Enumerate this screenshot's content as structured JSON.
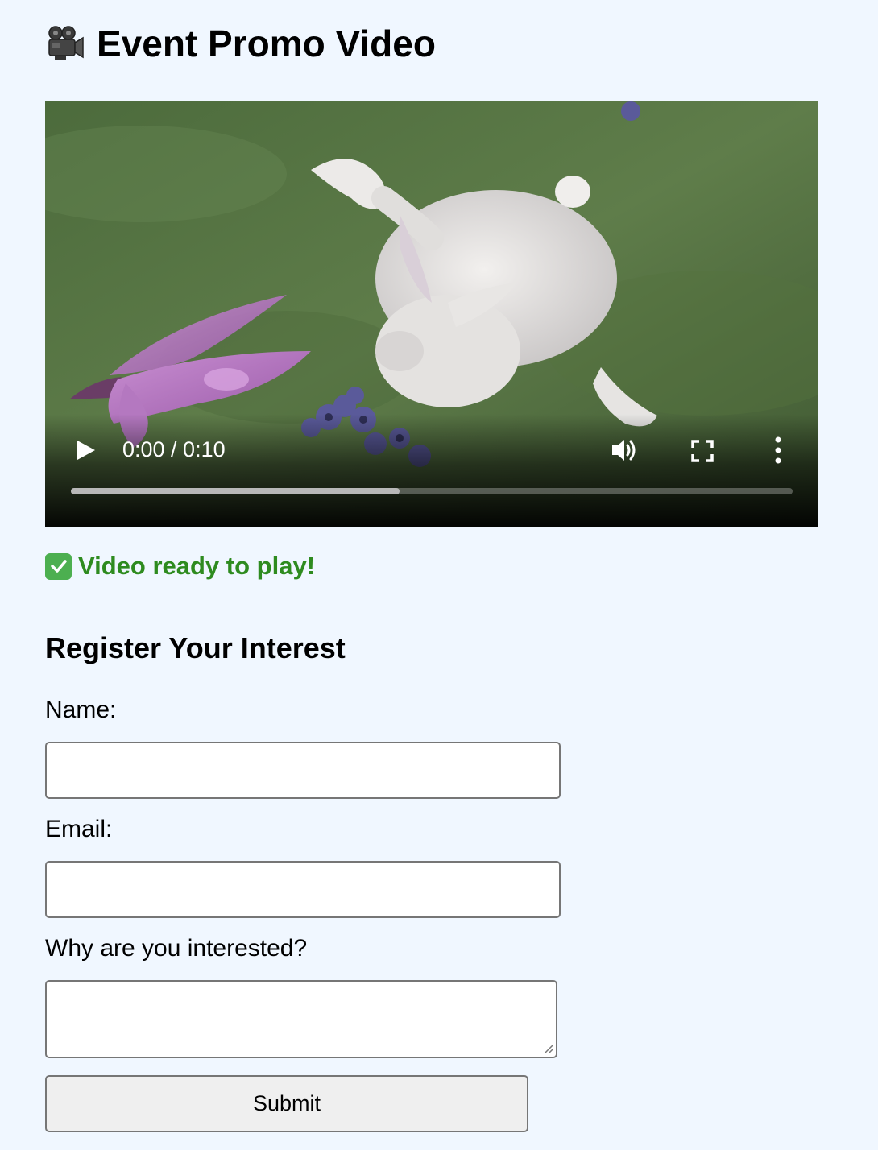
{
  "page": {
    "title": "Event Promo Video",
    "title_icon": "movie-camera-icon"
  },
  "video": {
    "time": "0:00 / 0:10",
    "progress_fraction": 0.455,
    "controls": [
      "play-icon",
      "volume-icon",
      "fullscreen-icon",
      "more-vert-icon"
    ]
  },
  "status": {
    "icon": "check-mark-icon",
    "text": "Video ready to play!",
    "color": "#2e8b1f"
  },
  "form": {
    "heading": "Register Your Interest",
    "name_label": "Name:",
    "name_value": "",
    "email_label": "Email:",
    "email_value": "",
    "reason_label": "Why are you interested?",
    "reason_value": "",
    "submit_label": "Submit"
  }
}
